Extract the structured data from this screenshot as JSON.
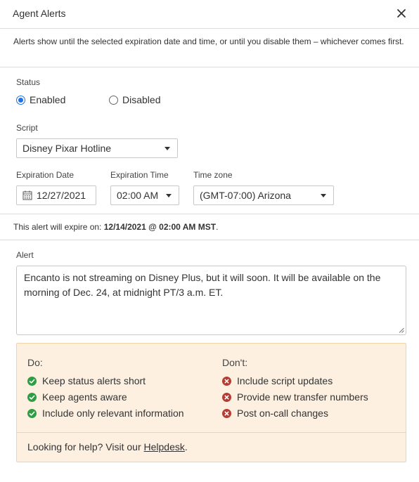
{
  "dialog": {
    "title": "Agent Alerts",
    "close_icon": "close-icon"
  },
  "notice": "Alerts show until the selected expiration date and time, or until you disable them – whichever comes first.",
  "status": {
    "label": "Status",
    "options": [
      "Enabled",
      "Disabled"
    ],
    "selected": "Enabled"
  },
  "script": {
    "label": "Script",
    "value": "Disney Pixar Hotline"
  },
  "expiration_date": {
    "label": "Expiration Date",
    "value": "12/27/2021",
    "icon": "calendar-icon"
  },
  "expiration_time": {
    "label": "Expiration Time",
    "value": "02:00 AM"
  },
  "time_zone": {
    "label": "Time zone",
    "value": "(GMT-07:00) Arizona"
  },
  "expire_summary": {
    "prefix": "This alert will expire on: ",
    "value": "12/14/2021 @ 02:00 AM MST",
    "suffix": "."
  },
  "alert": {
    "label": "Alert",
    "text": "Encanto is not streaming on Disney Plus, but it will soon. It will be available on the morning of Dec. 24, at midnight PT/3 a.m. ET."
  },
  "tips": {
    "do_title": "Do:",
    "do_items": [
      "Keep status alerts short",
      "Keep agents aware",
      "Include only relevant information"
    ],
    "dont_title": "Don't:",
    "dont_items": [
      "Include script updates",
      "Provide new transfer numbers",
      "Post on-call changes"
    ],
    "help_prefix": "Looking for help? Visit our ",
    "help_link": "Helpdesk",
    "help_suffix": "."
  },
  "colors": {
    "accent": "#1a73e8",
    "ok": "#2e9e44",
    "no": "#b43c32",
    "tips_bg": "#fdf0e1",
    "tips_border": "#f3d2a8"
  }
}
